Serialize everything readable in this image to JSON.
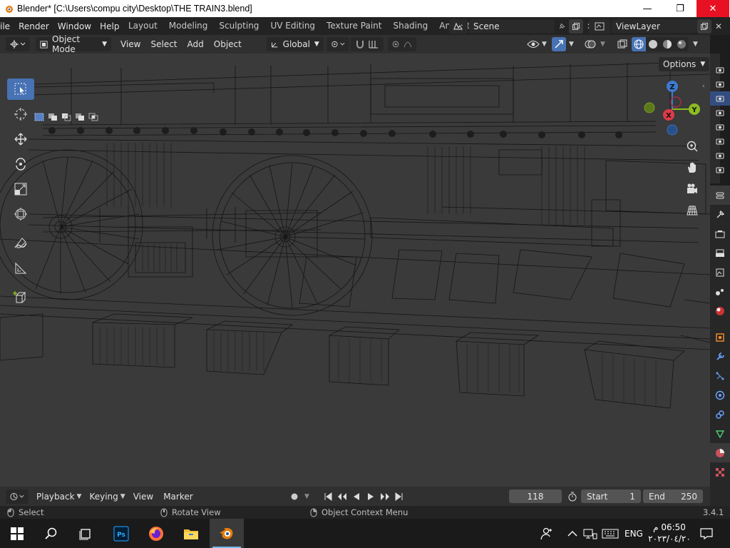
{
  "window": {
    "title": "Blender* [C:\\Users\\compu city\\Desktop\\THE TRAIN3.blend]",
    "minimize": "—",
    "maximize": "❐",
    "close": "✕"
  },
  "topbar": {
    "menus": [
      "ile",
      "Render",
      "Window",
      "Help"
    ],
    "workspaces": [
      "Layout",
      "Modeling",
      "Sculpting",
      "UV Editing",
      "Texture Paint",
      "Shading",
      "Animati"
    ],
    "scene": "Scene",
    "view_layer": "ViewLayer"
  },
  "viewport_header": {
    "mode": "Object Mode",
    "menus": [
      "View",
      "Select",
      "Add",
      "Object"
    ],
    "transform_orientation": "Global",
    "options_label": "Options"
  },
  "gizmo": {
    "z": "Z",
    "x": "X",
    "y": "Y"
  },
  "timeline": {
    "menus": [
      "Playback",
      "Keying",
      "View",
      "Marker"
    ],
    "current_frame": "118",
    "start_label": "Start",
    "start_value": "1",
    "end_label": "End",
    "end_value": "250"
  },
  "statusbar": {
    "select": "Select",
    "rotate": "Rotate View",
    "context_menu": "Object Context Menu",
    "version": "3.4.1"
  },
  "taskbar": {
    "language": "ENG",
    "time": "06:50 م",
    "date": "٢٠٢٣/٠٤/٢٠"
  },
  "colors": {
    "accent": "#4772b3",
    "axis_x": "#e03a4a",
    "axis_y": "#8bbb1f",
    "axis_z": "#3c7bd1",
    "close_button": "#e81123"
  }
}
